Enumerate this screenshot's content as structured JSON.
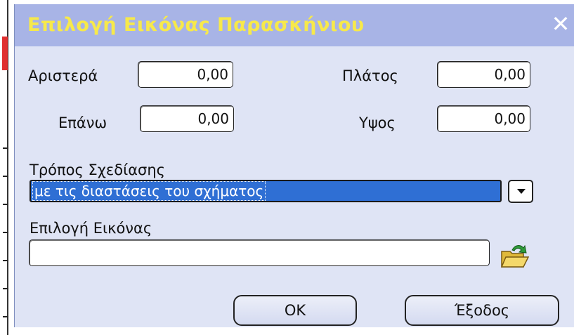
{
  "dialog": {
    "title": "Επιλογή Εικόνας Παρασκήνιου",
    "close_glyph": "✕",
    "fields": {
      "left_label": "Αριστερά",
      "left_value": "0,00",
      "top_label": "Επάνω",
      "top_value": "0,00",
      "width_label": "Πλάτος",
      "width_value": "0,00",
      "height_label": "Υψος",
      "height_value": "0,00"
    },
    "draw_mode": {
      "label": "Τρόπος Σχεδίασης",
      "selected": "με τις διαστάσεις του σχήματος"
    },
    "image_select": {
      "label": "Επιλογή Εικόνας",
      "value": "",
      "browse_icon": "folder-open-icon"
    },
    "buttons": {
      "ok": "OK",
      "exit": "Έξοδος"
    }
  },
  "colors": {
    "titlebar": "#a8b4e6",
    "title_text": "#f7e94a",
    "body": "#dfe4f5",
    "selection": "#2f6fd4"
  }
}
